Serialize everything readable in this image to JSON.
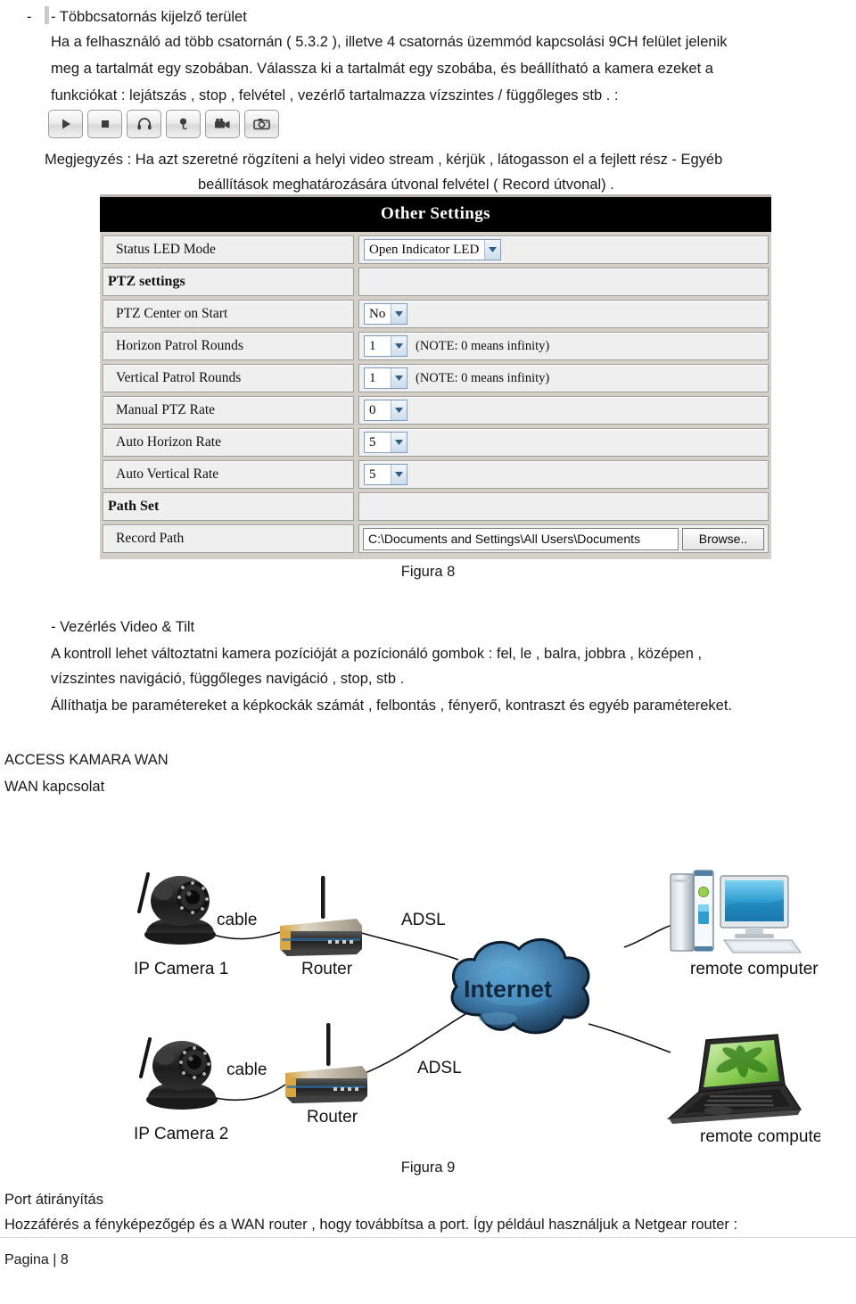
{
  "page": {
    "bullet": "-",
    "heading": "- Többcsatornás kijelző terület",
    "paragraph1_line1": "Ha a felhasználó ad több csatornán ( 5.3.2 ), illetve 4 csatornás üzemmód kapcsolási 9CH felület jelenik",
    "paragraph1_line2": "meg a tartalmát egy szobában. Válassza ki a tartalmát egy szobába, és beállítható a kamera ezeket a",
    "paragraph1_line3": "funkciókat : lejátszás , stop , felvétel , vezérlő tartalmazza vízszintes / függőleges stb . :",
    "note_line1": "Megjegyzés : Ha azt szeretné rögzíteni a helyi video stream , kérjük , látogasson el a fejlett rész - Egyéb",
    "note_line2": "beállítások meghatározására útvonal felvétel ( Record útvonal) .",
    "figure8_caption": "Figura 8",
    "section_control_title": "- Vezérlés Video & Tilt",
    "control_line1": "A kontroll lehet változtatni kamera pozícióját a pozícionáló gombok : fel, le , balra, jobbra , középen ,",
    "control_line2": "vízszintes navigáció, függőleges navigáció , stop, stb .",
    "control_line3": "Állíthatja be paramétereket a képkockák számát , felbontás , fényerő, kontraszt és egyéb paramétereket.",
    "access_title": "ACCESS KAMARA WAN",
    "access_sub": "WAN kapcsolat",
    "figure9_caption": "Figura 9",
    "port_title": "Port átirányítás",
    "port_line1": "Hozzáférés a fényképezőgép és a WAN router , hogy továbbítsa a port. Így például használjuk a Netgear router :",
    "footer": "Pagina | 8"
  },
  "toolbar": {
    "buttons": [
      {
        "icon": "play-icon",
        "label": "Play"
      },
      {
        "icon": "stop-icon",
        "label": "Stop"
      },
      {
        "icon": "audio-headphones-icon",
        "label": "Audio"
      },
      {
        "icon": "microphone-icon",
        "label": "Talk"
      },
      {
        "icon": "video-camera-icon",
        "label": "Record"
      },
      {
        "icon": "photo-camera-icon",
        "label": "Snapshot"
      }
    ]
  },
  "other_settings": {
    "title": "Other Settings",
    "rows": [
      {
        "label": "Status LED Mode",
        "type": "select",
        "value": "Open Indicator LED",
        "note": "",
        "bold": false
      },
      {
        "label": "PTZ settings",
        "type": "none",
        "value": "",
        "note": "",
        "bold": true
      },
      {
        "label": "PTZ Center on Start",
        "type": "select",
        "value": "No",
        "note": "",
        "bold": false
      },
      {
        "label": "Horizon Patrol Rounds",
        "type": "select",
        "value": "1",
        "note": "(NOTE: 0 means infinity)",
        "bold": false
      },
      {
        "label": "Vertical Patrol Rounds",
        "type": "select",
        "value": "1",
        "note": "(NOTE: 0 means infinity)",
        "bold": false
      },
      {
        "label": "Manual PTZ Rate",
        "type": "select",
        "value": "0",
        "note": "",
        "bold": false
      },
      {
        "label": "Auto Horizon Rate",
        "type": "select",
        "value": "5",
        "note": "",
        "bold": false
      },
      {
        "label": "Auto Vertical Rate",
        "type": "select",
        "value": "5",
        "note": "",
        "bold": false
      },
      {
        "label": "Path Set",
        "type": "none",
        "value": "",
        "note": "",
        "bold": true
      },
      {
        "label": "Record Path",
        "type": "path",
        "value": "C:\\Documents and Settings\\All Users\\Documents",
        "browse": "Browse..",
        "note": "",
        "bold": false
      }
    ]
  },
  "network_diagram": {
    "labels": {
      "camera1": "IP Camera 1",
      "camera2": "IP Camera 2",
      "cable1": "cable",
      "cable2": "cable",
      "router1": "Router",
      "router2": "Router",
      "adsl1": "ADSL",
      "adsl2": "ADSL",
      "internet": "Internet",
      "remote1": "remote computer",
      "remote2": "remote computer"
    },
    "colors": {
      "cloud_dark": "#1b3a57",
      "cloud_light": "#4a90c4",
      "monitor_blue": "#3aa6dd",
      "laptop_green": "#7ec64a"
    }
  }
}
